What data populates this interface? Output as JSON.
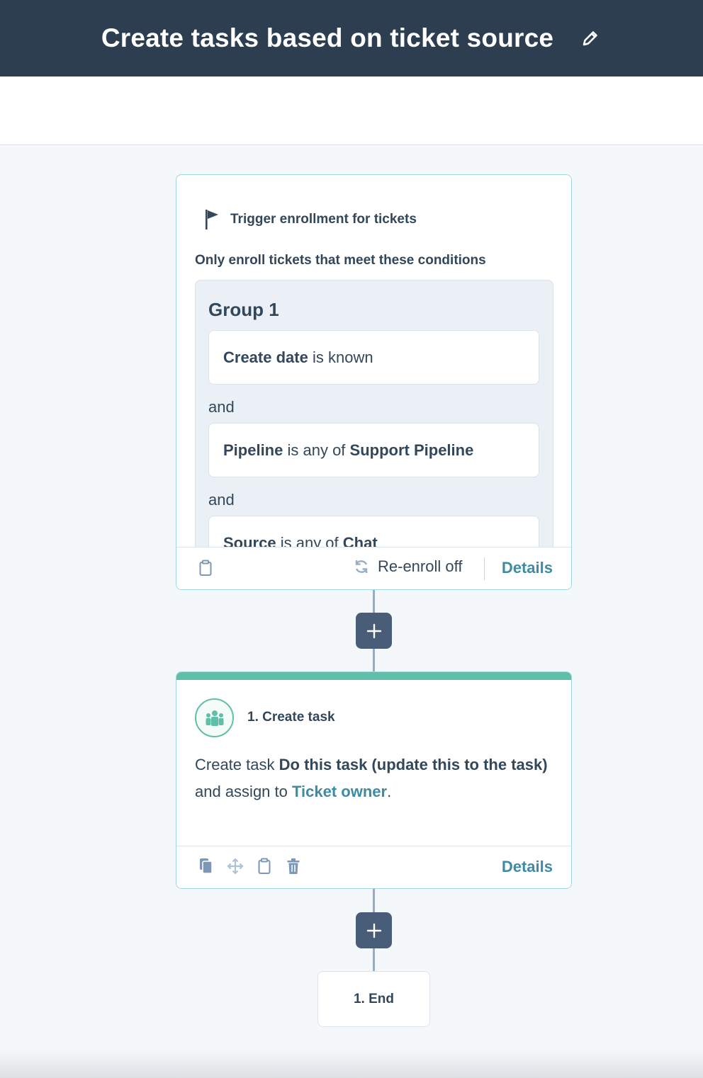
{
  "header": {
    "title": "Create tasks based on ticket source",
    "edit_icon": "pencil-icon"
  },
  "trigger": {
    "heading": "Trigger enrollment for tickets",
    "intro": "Only enroll tickets that meet these conditions",
    "group_title": "Group 1",
    "conditions": [
      {
        "property": "Create date",
        "operator": "is known",
        "value": ""
      },
      {
        "property": "Pipeline",
        "operator": "is any of",
        "value": "Support Pipeline"
      },
      {
        "property": "Source",
        "operator": "is any of",
        "value": "Chat"
      }
    ],
    "joiner": "and",
    "reenroll_label": "Re-enroll off",
    "details_label": "Details"
  },
  "action": {
    "title": "1. Create task",
    "desc_prefix": "Create task",
    "task_name": "Do this task (update this to the task)",
    "desc_middle": "and assign to",
    "assignee": "Ticket owner",
    "desc_suffix": ".",
    "details_label": "Details"
  },
  "end": {
    "label": "1. End"
  },
  "colors": {
    "header_bg": "#2d3e50",
    "accent_teal": "#5fbfa9",
    "link": "#3f8ba3",
    "plus_button": "#4a5d78"
  }
}
